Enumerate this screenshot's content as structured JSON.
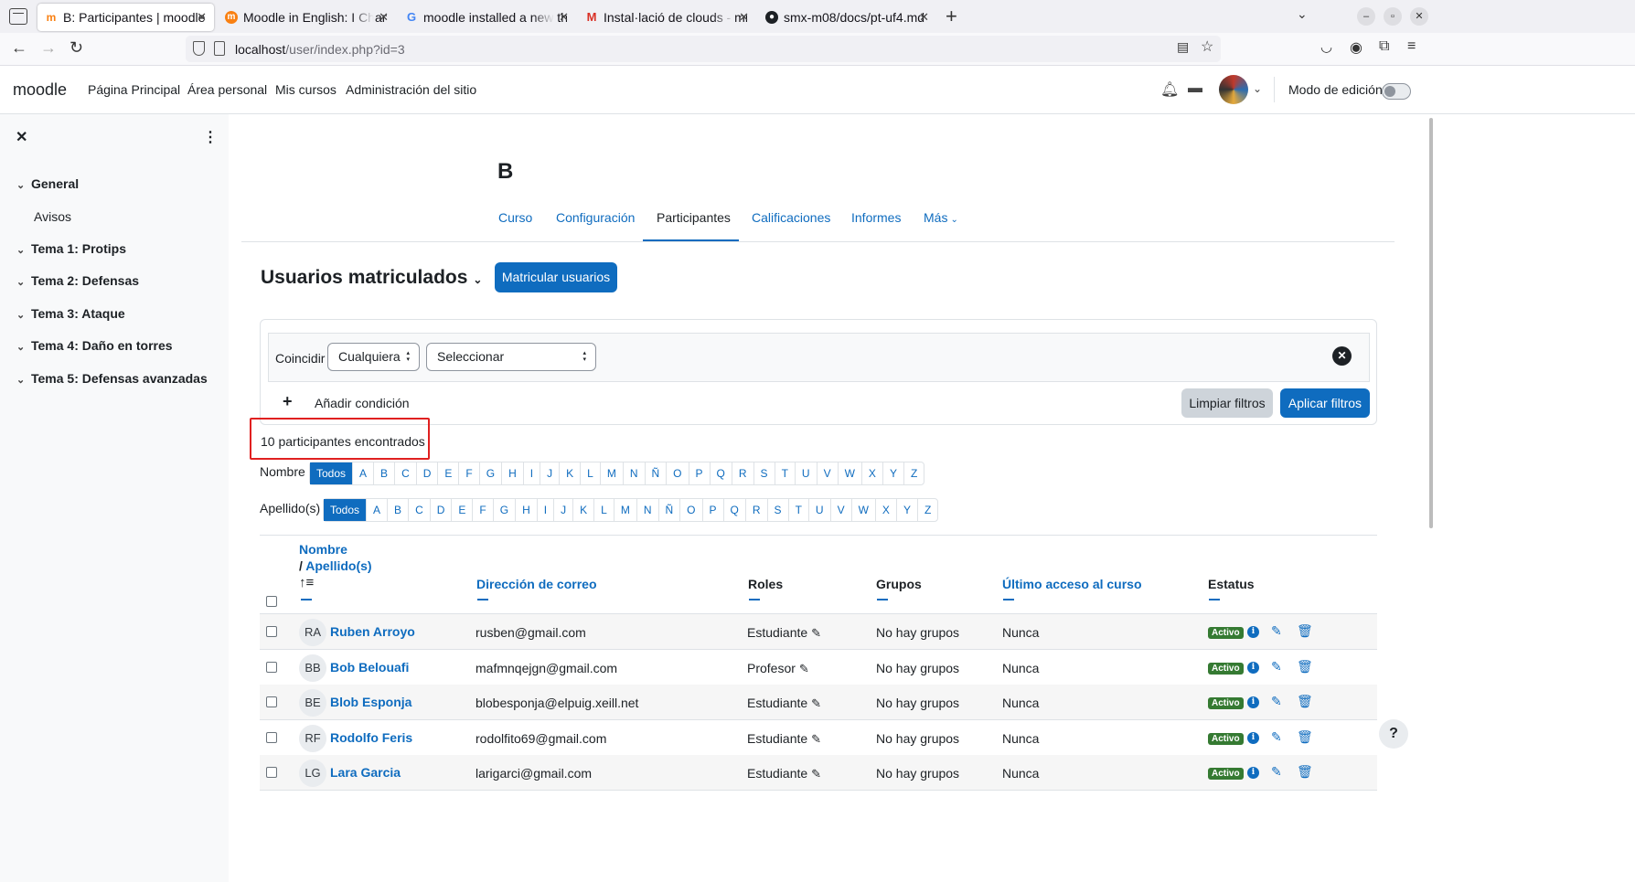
{
  "browser": {
    "tabs": [
      {
        "title": "B: Participantes | moodle",
        "active": true,
        "favicon": "moodle-icon"
      },
      {
        "title": "Moodle in English: I Change",
        "active": false,
        "favicon": "moodle-orange-icon"
      },
      {
        "title": "moodle installed a new th",
        "active": false,
        "favicon": "google-icon"
      },
      {
        "title": "Instal·lació de clouds - mr",
        "active": false,
        "favicon": "gmail-icon"
      },
      {
        "title": "smx-m08/docs/pt-uf4.md",
        "active": false,
        "favicon": "github-icon"
      }
    ],
    "url_host": "localhost",
    "url_path": "/user/index.php?id=3"
  },
  "moodle_nav": {
    "brand": "moodle",
    "links": [
      "Página Principal",
      "Área personal",
      "Mis cursos",
      "Administración del sitio"
    ],
    "edit_mode_label": "Modo de edición"
  },
  "drawer": {
    "sections": [
      {
        "label": "General",
        "items": [
          "Avisos"
        ]
      },
      {
        "label": "Tema 1: Protips",
        "items": []
      },
      {
        "label": "Tema 2: Defensas",
        "items": []
      },
      {
        "label": "Tema 3: Ataque",
        "items": []
      },
      {
        "label": "Tema 4: Daño en torres",
        "items": []
      },
      {
        "label": "Tema 5: Defensas avanzadas",
        "items": []
      }
    ]
  },
  "course": {
    "title": "B",
    "tabs": [
      "Curso",
      "Configuración",
      "Participantes",
      "Calificaciones",
      "Informes",
      "Más"
    ],
    "active_tab": "Participantes"
  },
  "participants": {
    "heading": "Usuarios matriculados",
    "enrol_button": "Matricular usuarios",
    "filter": {
      "match_label": "Coincidir",
      "match_value": "Cualquiera",
      "type_value": "Seleccionar",
      "add_condition": "Añadir condición",
      "clear_button": "Limpiar filtros",
      "apply_button": "Aplicar filtros"
    },
    "count_text": "10 participantes encontrados",
    "firstname_label": "Nombre",
    "lastname_label": "Apellido(s)",
    "initials_all": "Todos",
    "letters": [
      "A",
      "B",
      "C",
      "D",
      "E",
      "F",
      "G",
      "H",
      "I",
      "J",
      "K",
      "L",
      "M",
      "N",
      "Ñ",
      "O",
      "P",
      "Q",
      "R",
      "S",
      "T",
      "U",
      "V",
      "W",
      "X",
      "Y",
      "Z"
    ],
    "columns": {
      "name": "Nombre",
      "separator": "/",
      "surname": "Apellido(s)",
      "email": "Dirección de correo",
      "roles": "Roles",
      "groups": "Grupos",
      "last_access": "Último acceso al curso",
      "status": "Estatus"
    },
    "rows": [
      {
        "initials": "RA",
        "name": "Ruben Arroyo",
        "email": "rusben@gmail.com",
        "role": "Estudiante",
        "groups": "No hay grupos",
        "last_access": "Nunca",
        "status": "Activo"
      },
      {
        "initials": "BB",
        "name": "Bob Belouafi",
        "email": "mafmnqejgn@gmail.com",
        "role": "Profesor",
        "groups": "No hay grupos",
        "last_access": "Nunca",
        "status": "Activo"
      },
      {
        "initials": "BE",
        "name": "Blob Esponja",
        "email": "blobesponja@elpuig.xeill.net",
        "role": "Estudiante",
        "groups": "No hay grupos",
        "last_access": "Nunca",
        "status": "Activo"
      },
      {
        "initials": "RF",
        "name": "Rodolfo Feris",
        "email": "rodolfito69@gmail.com",
        "role": "Estudiante",
        "groups": "No hay grupos",
        "last_access": "Nunca",
        "status": "Activo"
      },
      {
        "initials": "LG",
        "name": "Lara Garcia",
        "email": "larigarci@gmail.com",
        "role": "Estudiante",
        "groups": "No hay grupos",
        "last_access": "Nunca",
        "status": "Activo"
      }
    ]
  },
  "colors": {
    "primary": "#0f6cbf",
    "success": "#357a32",
    "highlight_box": "#e02020"
  }
}
